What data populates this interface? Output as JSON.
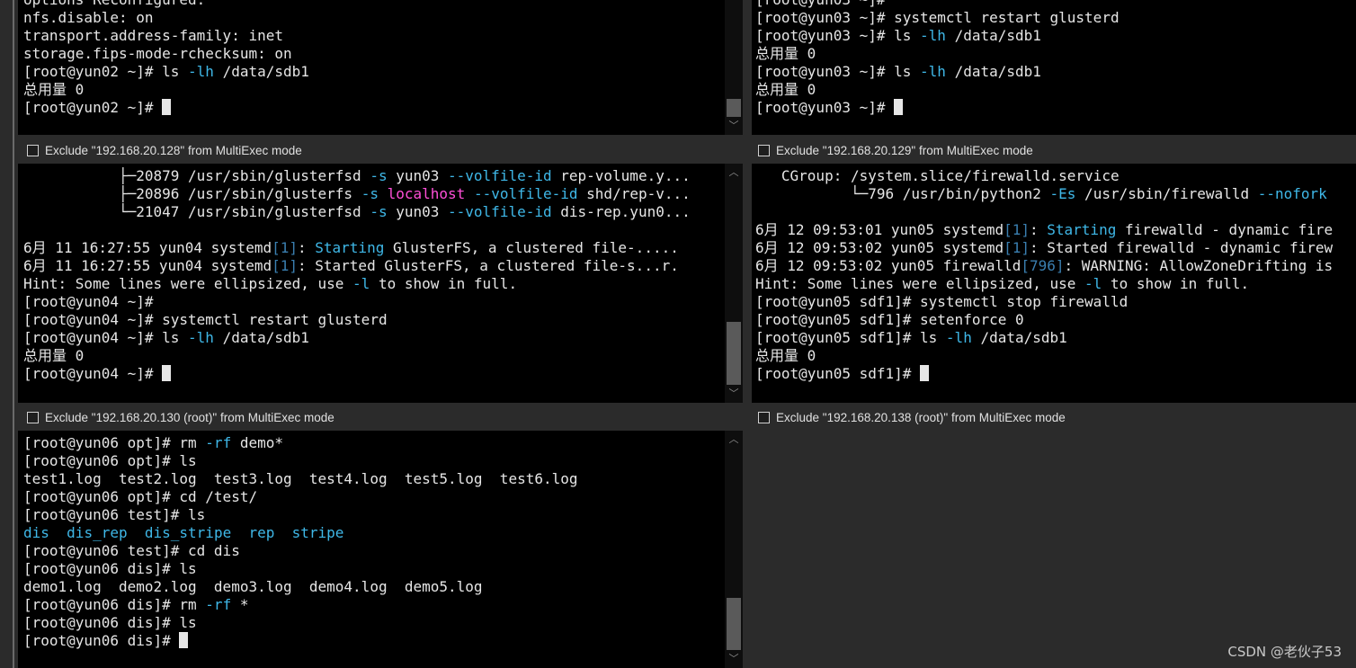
{
  "panes": {
    "p1": {
      "lines": [
        [
          {
            "t": "options Reconfigured:"
          }
        ],
        [
          {
            "t": "nfs.disable: on"
          }
        ],
        [
          {
            "t": "transport.address-family: inet"
          }
        ],
        [
          {
            "t": "storage.fips-mode-rchecksum: on"
          }
        ],
        [
          {
            "t": "[root@yun02 ~]# ls "
          },
          {
            "t": "-lh",
            "c": "cyan"
          },
          {
            "t": " /data/sdb1"
          }
        ],
        [
          {
            "t": "总用量 0"
          }
        ],
        [
          {
            "t": "[root@yun02 ~]# "
          },
          {
            "cursor": true
          }
        ]
      ]
    },
    "p2": {
      "lines": [
        [
          {
            "t": "[root@yun03 ~]#"
          }
        ],
        [
          {
            "t": "[root@yun03 ~]# systemctl restart glusterd"
          }
        ],
        [
          {
            "t": "[root@yun03 ~]# ls "
          },
          {
            "t": "-lh",
            "c": "cyan"
          },
          {
            "t": " /data/sdb1"
          }
        ],
        [
          {
            "t": "总用量 0"
          }
        ],
        [
          {
            "t": "[root@yun03 ~]# ls "
          },
          {
            "t": "-lh",
            "c": "cyan"
          },
          {
            "t": " /data/sdb1"
          }
        ],
        [
          {
            "t": "总用量 0"
          }
        ],
        [
          {
            "t": "[root@yun03 ~]# "
          },
          {
            "cursor": true
          }
        ]
      ]
    },
    "p3": {
      "exclude_label": "Exclude \"192.168.20.128\" from MultiExec mode",
      "lines": [
        [
          {
            "t": "           ├─20879 /usr/sbin/glusterfsd "
          },
          {
            "t": "-s",
            "c": "cyan"
          },
          {
            "t": " yun03 "
          },
          {
            "t": "--volfile-id",
            "c": "cyan"
          },
          {
            "t": " rep-volume.y..."
          }
        ],
        [
          {
            "t": "           ├─20896 /usr/sbin/glusterfs "
          },
          {
            "t": "-s",
            "c": "cyan"
          },
          {
            "t": " "
          },
          {
            "t": "localhost",
            "c": "mag"
          },
          {
            "t": " "
          },
          {
            "t": "--volfile-id",
            "c": "cyan"
          },
          {
            "t": " shd/rep-v..."
          }
        ],
        [
          {
            "t": "           └─21047 /usr/sbin/glusterfsd "
          },
          {
            "t": "-s",
            "c": "cyan"
          },
          {
            "t": " yun03 "
          },
          {
            "t": "--volfile-id",
            "c": "cyan"
          },
          {
            "t": " dis-rep.yun0..."
          }
        ],
        [
          {
            "t": ""
          }
        ],
        [
          {
            "t": "6月 11 16:27:55 yun04 systemd"
          },
          {
            "t": "[1]",
            "c": "dim"
          },
          {
            "t": ": "
          },
          {
            "t": "Starting",
            "c": "cyan"
          },
          {
            "t": " GlusterFS, a clustered file-....."
          }
        ],
        [
          {
            "t": "6月 11 16:27:55 yun04 systemd"
          },
          {
            "t": "[1]",
            "c": "dim"
          },
          {
            "t": ": Started GlusterFS, a clustered file-s...r."
          }
        ],
        [
          {
            "t": "Hint: Some lines were ellipsized, use "
          },
          {
            "t": "-l",
            "c": "cyan"
          },
          {
            "t": " to show in full."
          }
        ],
        [
          {
            "t": "[root@yun04 ~]#"
          }
        ],
        [
          {
            "t": "[root@yun04 ~]# systemctl restart glusterd"
          }
        ],
        [
          {
            "t": "[root@yun04 ~]# ls "
          },
          {
            "t": "-lh",
            "c": "cyan"
          },
          {
            "t": " /data/sdb1"
          }
        ],
        [
          {
            "t": "总用量 0"
          }
        ],
        [
          {
            "t": "[root@yun04 ~]# "
          },
          {
            "cursor": true
          }
        ]
      ]
    },
    "p4": {
      "exclude_label": "Exclude \"192.168.20.129\" from MultiExec mode",
      "lines": [
        [
          {
            "t": "   CGroup: /system.slice/firewalld.service"
          }
        ],
        [
          {
            "t": "           └─796 /usr/bin/python2 "
          },
          {
            "t": "-Es",
            "c": "cyan"
          },
          {
            "t": " /usr/sbin/firewalld "
          },
          {
            "t": "--nofork",
            "c": "cyan"
          }
        ],
        [
          {
            "t": ""
          }
        ],
        [
          {
            "t": "6月 12 09:53:01 yun05 systemd"
          },
          {
            "t": "[1]",
            "c": "dim"
          },
          {
            "t": ": "
          },
          {
            "t": "Starting",
            "c": "cyan"
          },
          {
            "t": " firewalld - dynamic fire"
          }
        ],
        [
          {
            "t": "6月 12 09:53:02 yun05 systemd"
          },
          {
            "t": "[1]",
            "c": "dim"
          },
          {
            "t": ": Started firewalld - dynamic firew"
          }
        ],
        [
          {
            "t": "6月 12 09:53:02 yun05 firewalld"
          },
          {
            "t": "[796]",
            "c": "dim"
          },
          {
            "t": ": WARNING: AllowZoneDrifting is"
          }
        ],
        [
          {
            "t": "Hint: Some lines were ellipsized, use "
          },
          {
            "t": "-l",
            "c": "cyan"
          },
          {
            "t": " to show in full."
          }
        ],
        [
          {
            "t": "[root@yun05 sdf1]# systemctl stop firewalld"
          }
        ],
        [
          {
            "t": "[root@yun05 sdf1]# setenforce 0"
          }
        ],
        [
          {
            "t": "[root@yun05 sdf1]# ls "
          },
          {
            "t": "-lh",
            "c": "cyan"
          },
          {
            "t": " /data/sdb1"
          }
        ],
        [
          {
            "t": "总用量 0"
          }
        ],
        [
          {
            "t": "[root@yun05 sdf1]# "
          },
          {
            "cursor": true
          }
        ]
      ]
    },
    "p5": {
      "exclude_label": "Exclude \"192.168.20.130 (root)\" from MultiExec mode",
      "lines": [
        [
          {
            "t": "[root@yun06 opt]# rm "
          },
          {
            "t": "-rf",
            "c": "cyan"
          },
          {
            "t": " demo*"
          }
        ],
        [
          {
            "t": "[root@yun06 opt]# ls"
          }
        ],
        [
          {
            "t": "test1.log  test2.log  test3.log  test4.log  test5.log  test6.log"
          }
        ],
        [
          {
            "t": "[root@yun06 opt]# cd /test/"
          }
        ],
        [
          {
            "t": "[root@yun06 test]# ls"
          }
        ],
        [
          {
            "t": "dis",
            "c": "cyan"
          },
          {
            "t": "  "
          },
          {
            "t": "dis_rep",
            "c": "cyan"
          },
          {
            "t": "  "
          },
          {
            "t": "dis_stripe",
            "c": "cyan"
          },
          {
            "t": "  "
          },
          {
            "t": "rep",
            "c": "cyan"
          },
          {
            "t": "  "
          },
          {
            "t": "stripe",
            "c": "cyan"
          }
        ],
        [
          {
            "t": "[root@yun06 test]# cd dis"
          }
        ],
        [
          {
            "t": "[root@yun06 dis]# ls"
          }
        ],
        [
          {
            "t": "demo1.log  demo2.log  demo3.log  demo4.log  demo5.log"
          }
        ],
        [
          {
            "t": "[root@yun06 dis]# rm "
          },
          {
            "t": "-rf",
            "c": "cyan"
          },
          {
            "t": " *"
          }
        ],
        [
          {
            "t": "[root@yun06 dis]# ls"
          }
        ],
        [
          {
            "t": "[root@yun06 dis]# "
          },
          {
            "cursor": true
          }
        ]
      ]
    },
    "p6": {
      "exclude_label": "Exclude \"192.168.20.138 (root)\" from MultiExec mode",
      "lines": []
    }
  },
  "scrollbar": {
    "up_arrow": "︿",
    "down_arrow": "﹀"
  },
  "watermark": "CSDN @老伙子53",
  "colors": {
    "terminal_bg": "#000000",
    "text": "#e6e6e6",
    "cyan": "#3fb8e8",
    "magenta": "#ff4fd8",
    "dim_blue": "#3a7fb0",
    "frame": "#2b2b2b"
  }
}
